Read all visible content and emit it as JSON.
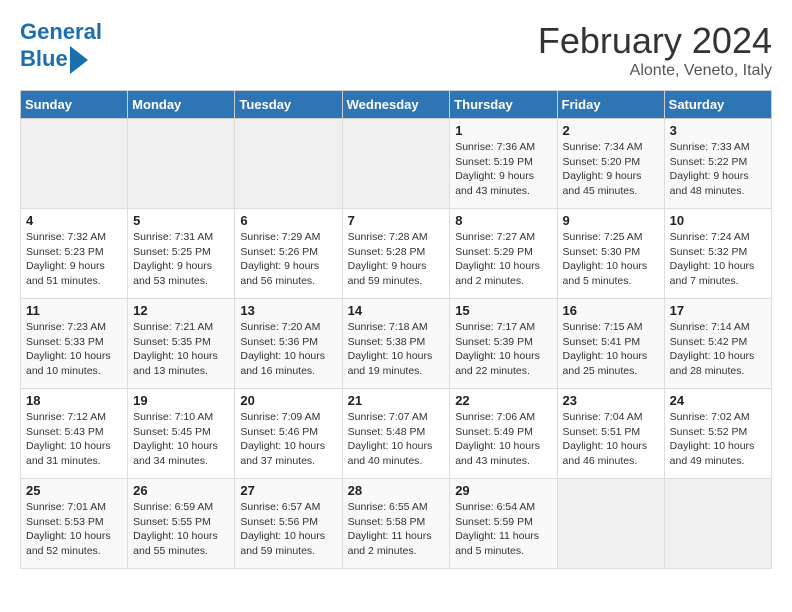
{
  "header": {
    "logo_line1": "General",
    "logo_line2": "Blue",
    "month": "February 2024",
    "location": "Alonte, Veneto, Italy"
  },
  "columns": [
    "Sunday",
    "Monday",
    "Tuesday",
    "Wednesday",
    "Thursday",
    "Friday",
    "Saturday"
  ],
  "weeks": [
    [
      {
        "day": "",
        "info": ""
      },
      {
        "day": "",
        "info": ""
      },
      {
        "day": "",
        "info": ""
      },
      {
        "day": "",
        "info": ""
      },
      {
        "day": "1",
        "info": "Sunrise: 7:36 AM\nSunset: 5:19 PM\nDaylight: 9 hours and 43 minutes."
      },
      {
        "day": "2",
        "info": "Sunrise: 7:34 AM\nSunset: 5:20 PM\nDaylight: 9 hours and 45 minutes."
      },
      {
        "day": "3",
        "info": "Sunrise: 7:33 AM\nSunset: 5:22 PM\nDaylight: 9 hours and 48 minutes."
      }
    ],
    [
      {
        "day": "4",
        "info": "Sunrise: 7:32 AM\nSunset: 5:23 PM\nDaylight: 9 hours and 51 minutes."
      },
      {
        "day": "5",
        "info": "Sunrise: 7:31 AM\nSunset: 5:25 PM\nDaylight: 9 hours and 53 minutes."
      },
      {
        "day": "6",
        "info": "Sunrise: 7:29 AM\nSunset: 5:26 PM\nDaylight: 9 hours and 56 minutes."
      },
      {
        "day": "7",
        "info": "Sunrise: 7:28 AM\nSunset: 5:28 PM\nDaylight: 9 hours and 59 minutes."
      },
      {
        "day": "8",
        "info": "Sunrise: 7:27 AM\nSunset: 5:29 PM\nDaylight: 10 hours and 2 minutes."
      },
      {
        "day": "9",
        "info": "Sunrise: 7:25 AM\nSunset: 5:30 PM\nDaylight: 10 hours and 5 minutes."
      },
      {
        "day": "10",
        "info": "Sunrise: 7:24 AM\nSunset: 5:32 PM\nDaylight: 10 hours and 7 minutes."
      }
    ],
    [
      {
        "day": "11",
        "info": "Sunrise: 7:23 AM\nSunset: 5:33 PM\nDaylight: 10 hours and 10 minutes."
      },
      {
        "day": "12",
        "info": "Sunrise: 7:21 AM\nSunset: 5:35 PM\nDaylight: 10 hours and 13 minutes."
      },
      {
        "day": "13",
        "info": "Sunrise: 7:20 AM\nSunset: 5:36 PM\nDaylight: 10 hours and 16 minutes."
      },
      {
        "day": "14",
        "info": "Sunrise: 7:18 AM\nSunset: 5:38 PM\nDaylight: 10 hours and 19 minutes."
      },
      {
        "day": "15",
        "info": "Sunrise: 7:17 AM\nSunset: 5:39 PM\nDaylight: 10 hours and 22 minutes."
      },
      {
        "day": "16",
        "info": "Sunrise: 7:15 AM\nSunset: 5:41 PM\nDaylight: 10 hours and 25 minutes."
      },
      {
        "day": "17",
        "info": "Sunrise: 7:14 AM\nSunset: 5:42 PM\nDaylight: 10 hours and 28 minutes."
      }
    ],
    [
      {
        "day": "18",
        "info": "Sunrise: 7:12 AM\nSunset: 5:43 PM\nDaylight: 10 hours and 31 minutes."
      },
      {
        "day": "19",
        "info": "Sunrise: 7:10 AM\nSunset: 5:45 PM\nDaylight: 10 hours and 34 minutes."
      },
      {
        "day": "20",
        "info": "Sunrise: 7:09 AM\nSunset: 5:46 PM\nDaylight: 10 hours and 37 minutes."
      },
      {
        "day": "21",
        "info": "Sunrise: 7:07 AM\nSunset: 5:48 PM\nDaylight: 10 hours and 40 minutes."
      },
      {
        "day": "22",
        "info": "Sunrise: 7:06 AM\nSunset: 5:49 PM\nDaylight: 10 hours and 43 minutes."
      },
      {
        "day": "23",
        "info": "Sunrise: 7:04 AM\nSunset: 5:51 PM\nDaylight: 10 hours and 46 minutes."
      },
      {
        "day": "24",
        "info": "Sunrise: 7:02 AM\nSunset: 5:52 PM\nDaylight: 10 hours and 49 minutes."
      }
    ],
    [
      {
        "day": "25",
        "info": "Sunrise: 7:01 AM\nSunset: 5:53 PM\nDaylight: 10 hours and 52 minutes."
      },
      {
        "day": "26",
        "info": "Sunrise: 6:59 AM\nSunset: 5:55 PM\nDaylight: 10 hours and 55 minutes."
      },
      {
        "day": "27",
        "info": "Sunrise: 6:57 AM\nSunset: 5:56 PM\nDaylight: 10 hours and 59 minutes."
      },
      {
        "day": "28",
        "info": "Sunrise: 6:55 AM\nSunset: 5:58 PM\nDaylight: 11 hours and 2 minutes."
      },
      {
        "day": "29",
        "info": "Sunrise: 6:54 AM\nSunset: 5:59 PM\nDaylight: 11 hours and 5 minutes."
      },
      {
        "day": "",
        "info": ""
      },
      {
        "day": "",
        "info": ""
      }
    ]
  ]
}
